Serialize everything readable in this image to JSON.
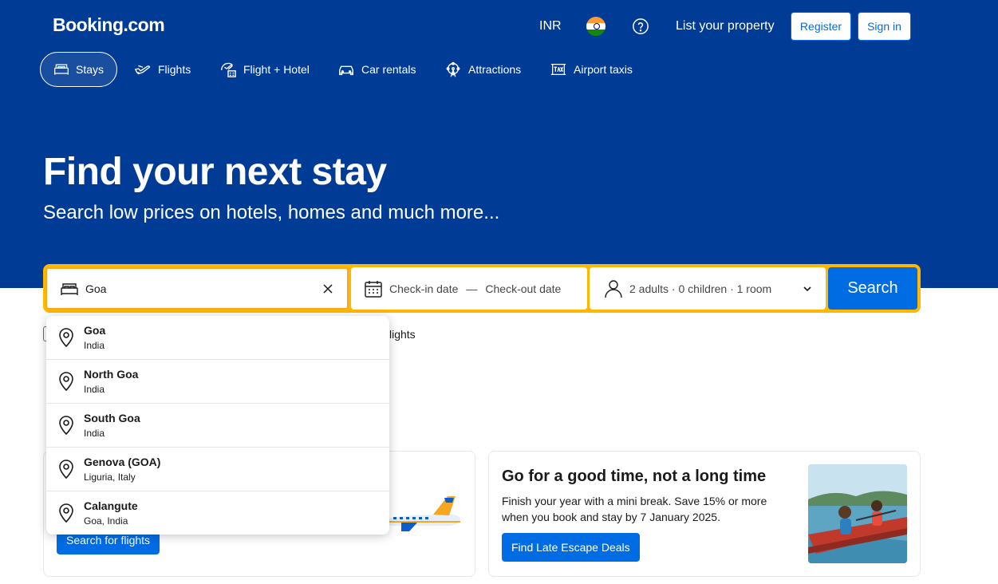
{
  "header": {
    "logo": "Booking.com",
    "currency": "INR",
    "flag_icon": "india-flag-icon",
    "help_icon": "question-circle-icon",
    "list_property": "List your property",
    "register": "Register",
    "sign_in": "Sign in"
  },
  "nav": {
    "items": [
      {
        "label": "Stays",
        "icon": "bed-icon",
        "active": true
      },
      {
        "label": "Flights",
        "icon": "plane-icon"
      },
      {
        "label": "Flight + Hotel",
        "icon": "flight-hotel-icon"
      },
      {
        "label": "Car rentals",
        "icon": "car-icon"
      },
      {
        "label": "Attractions",
        "icon": "ferris-wheel-icon"
      },
      {
        "label": "Airport taxis",
        "icon": "taxi-icon"
      }
    ]
  },
  "hero": {
    "title": "Find your next stay",
    "subtitle": "Search low prices on hotels, homes and much more..."
  },
  "search": {
    "destination_value": "Goa",
    "checkin": "Check-in date",
    "separator": "—",
    "checkout": "Check-out date",
    "occupancy": "2 adults · 0 children · 1 room",
    "button": "Search"
  },
  "behind": {
    "flights_tail": "lights"
  },
  "suggestions": [
    {
      "name": "Goa",
      "sub": "India"
    },
    {
      "name": "North Goa",
      "sub": "India"
    },
    {
      "name": "South Goa",
      "sub": "India"
    },
    {
      "name": "Genova (GOA)",
      "sub": "Liguria, Italy"
    },
    {
      "name": "Calangute",
      "sub": "Goa, India"
    }
  ],
  "cards": {
    "flights_button": "Search for flights",
    "promo_title": "Go for a good time, not a long time",
    "promo_text": "Finish your year with a mini break. Save 15% or more when you book and stay by 7 January 2025.",
    "promo_button": "Find Late Escape Deals"
  },
  "colors": {
    "brand_blue": "#003b95",
    "accent_blue": "#006ce4",
    "search_border": "#ffb700"
  }
}
